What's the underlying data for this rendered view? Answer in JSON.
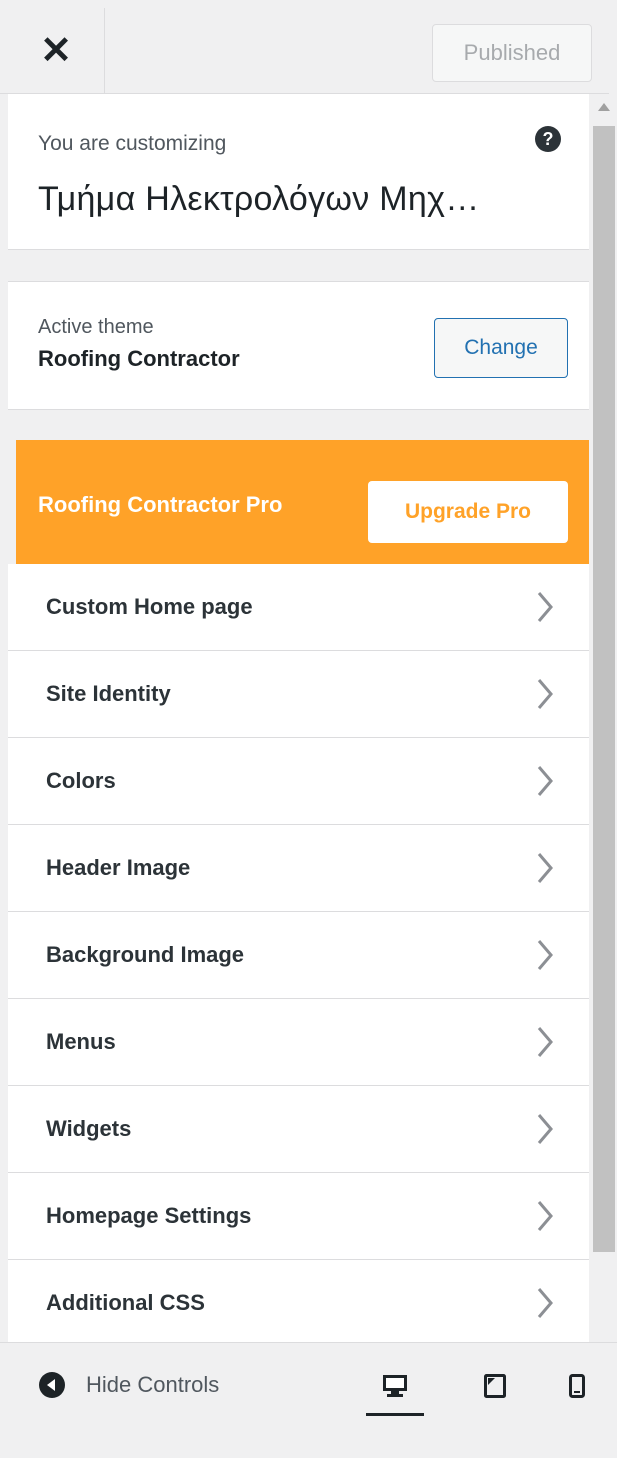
{
  "header": {
    "close_label": "✕",
    "publish_label": "Published"
  },
  "info": {
    "customizing_label": "You are customizing",
    "site_title": "Τμήμα Ηλεκτρολόγων Μηχ…",
    "help_glyph": "?"
  },
  "theme": {
    "active_label": "Active theme",
    "name": "Roofing Contractor",
    "change_label": "Change"
  },
  "pro": {
    "label": "Roofing Contractor Pro",
    "button": "Upgrade Pro",
    "color": "#ffa228"
  },
  "menu": {
    "items": [
      {
        "label": "Custom Home page"
      },
      {
        "label": "Site Identity"
      },
      {
        "label": "Colors"
      },
      {
        "label": "Header Image"
      },
      {
        "label": "Background Image"
      },
      {
        "label": "Menus"
      },
      {
        "label": "Widgets"
      },
      {
        "label": "Homepage Settings"
      },
      {
        "label": "Additional CSS"
      }
    ]
  },
  "footer": {
    "hide_label": "Hide Controls",
    "devices": [
      "desktop-icon",
      "tablet-icon",
      "mobile-icon"
    ]
  },
  "icons": {
    "close": "close-icon",
    "help": "help-icon",
    "chevron": "chevron-right-icon",
    "collapse": "collapse-icon"
  }
}
